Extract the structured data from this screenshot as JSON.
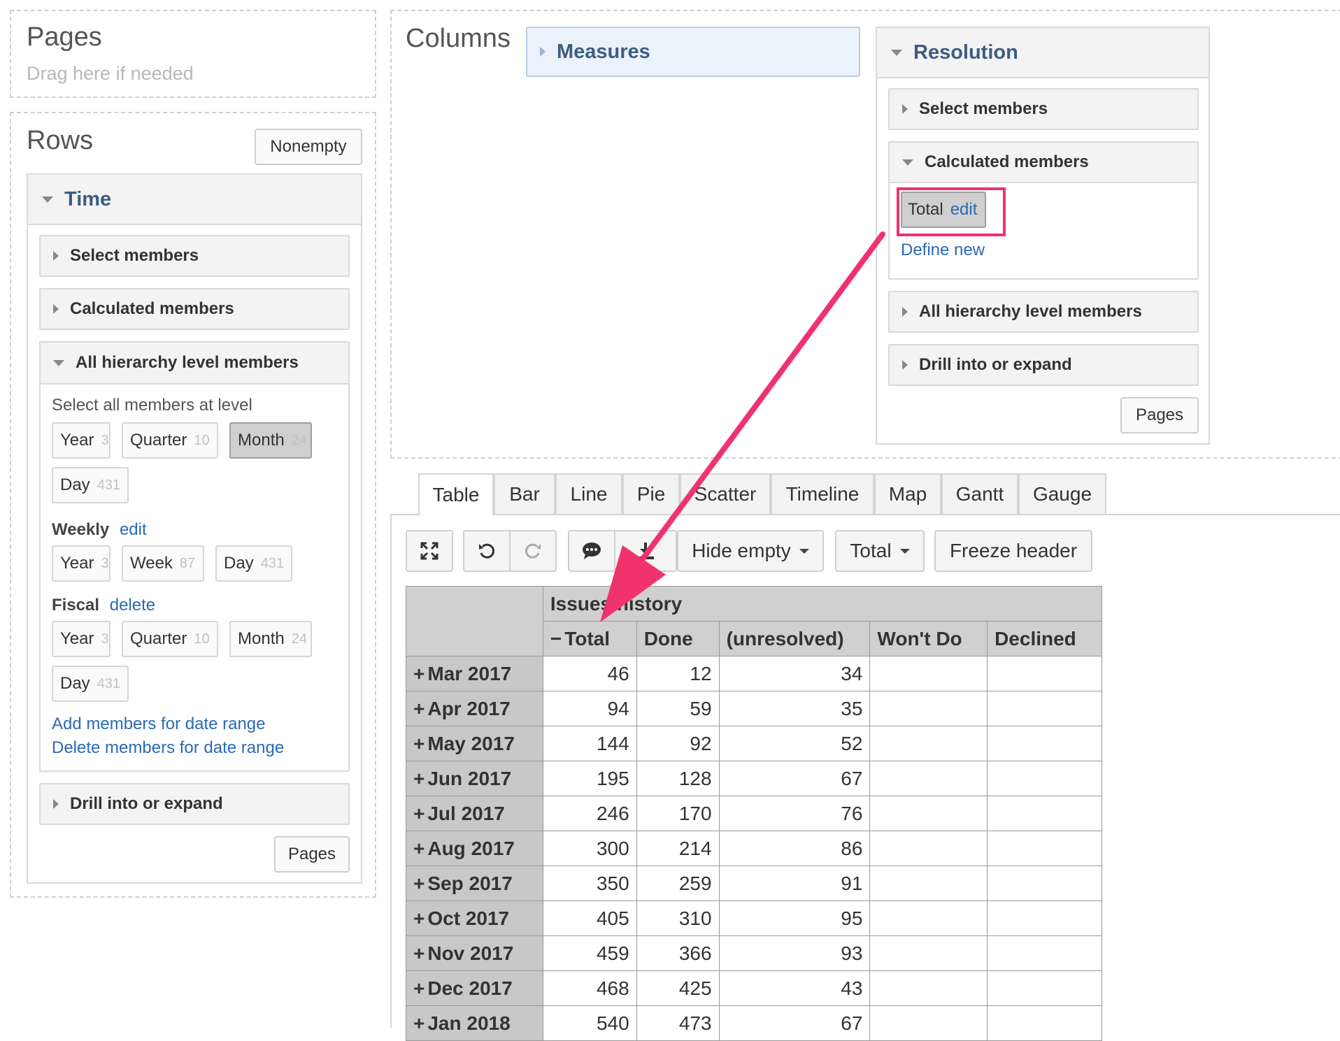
{
  "pages": {
    "title": "Pages",
    "hint": "Drag here if needed"
  },
  "rows": {
    "title": "Rows",
    "nonempty_label": "Nonempty",
    "dimension": "Time",
    "select_members": "Select members",
    "calculated_members": "Calculated members",
    "all_levels": "All hierarchy level members",
    "select_all_at_level": "Select all members at level",
    "default_levels": [
      {
        "name": "Year",
        "count": "3"
      },
      {
        "name": "Quarter",
        "count": "10"
      },
      {
        "name": "Month",
        "count": "24"
      },
      {
        "name": "Day",
        "count": "431"
      }
    ],
    "weekly": {
      "label": "Weekly",
      "action": "edit",
      "levels": [
        {
          "name": "Year",
          "count": "3"
        },
        {
          "name": "Week",
          "count": "87"
        },
        {
          "name": "Day",
          "count": "431"
        }
      ]
    },
    "fiscal": {
      "label": "Fiscal",
      "action": "delete",
      "levels": [
        {
          "name": "Year",
          "count": "3"
        },
        {
          "name": "Quarter",
          "count": "10"
        },
        {
          "name": "Month",
          "count": "24"
        },
        {
          "name": "Day",
          "count": "431"
        }
      ]
    },
    "add_range": "Add members for date range",
    "delete_range": "Delete members for date range",
    "drill": "Drill into or expand",
    "pages_button": "Pages"
  },
  "columns": {
    "title": "Columns",
    "measures": "Measures",
    "resolution": {
      "title": "Resolution",
      "select_members": "Select members",
      "calculated_members": "Calculated members",
      "calc_member_name": "Total",
      "calc_member_edit": "edit",
      "define_new": "Define new",
      "all_levels": "All hierarchy level members",
      "drill": "Drill into or expand",
      "pages_button": "Pages"
    }
  },
  "tabs": [
    "Table",
    "Bar",
    "Line",
    "Pie",
    "Scatter",
    "Timeline",
    "Map",
    "Gantt",
    "Gauge"
  ],
  "toolbar": {
    "hide_empty": "Hide empty",
    "total": "Total",
    "freeze_header": "Freeze header",
    "icons": [
      "expand-icon",
      "undo-icon",
      "redo-icon",
      "comment-icon",
      "download-icon"
    ]
  },
  "table": {
    "group_header": "Issues history",
    "columns": [
      "Total",
      "Done",
      "(unresolved)",
      "Won't Do",
      "Declined"
    ],
    "rows": [
      {
        "label": "Mar 2017",
        "values": [
          "46",
          "12",
          "34",
          "",
          ""
        ]
      },
      {
        "label": "Apr 2017",
        "values": [
          "94",
          "59",
          "35",
          "",
          ""
        ]
      },
      {
        "label": "May 2017",
        "values": [
          "144",
          "92",
          "52",
          "",
          ""
        ]
      },
      {
        "label": "Jun 2017",
        "values": [
          "195",
          "128",
          "67",
          "",
          ""
        ]
      },
      {
        "label": "Jul 2017",
        "values": [
          "246",
          "170",
          "76",
          "",
          ""
        ]
      },
      {
        "label": "Aug 2017",
        "values": [
          "300",
          "214",
          "86",
          "",
          ""
        ]
      },
      {
        "label": "Sep 2017",
        "values": [
          "350",
          "259",
          "91",
          "",
          ""
        ]
      },
      {
        "label": "Oct 2017",
        "values": [
          "405",
          "310",
          "95",
          "",
          ""
        ]
      },
      {
        "label": "Nov 2017",
        "values": [
          "459",
          "366",
          "93",
          "",
          ""
        ]
      },
      {
        "label": "Dec 2017",
        "values": [
          "468",
          "425",
          "43",
          "",
          ""
        ]
      },
      {
        "label": "Jan 2018",
        "values": [
          "540",
          "473",
          "67",
          "",
          ""
        ]
      }
    ]
  },
  "colors": {
    "accent_arrow": "#f0326e",
    "link": "#2a6ab4",
    "heading": "#3d5c80"
  }
}
